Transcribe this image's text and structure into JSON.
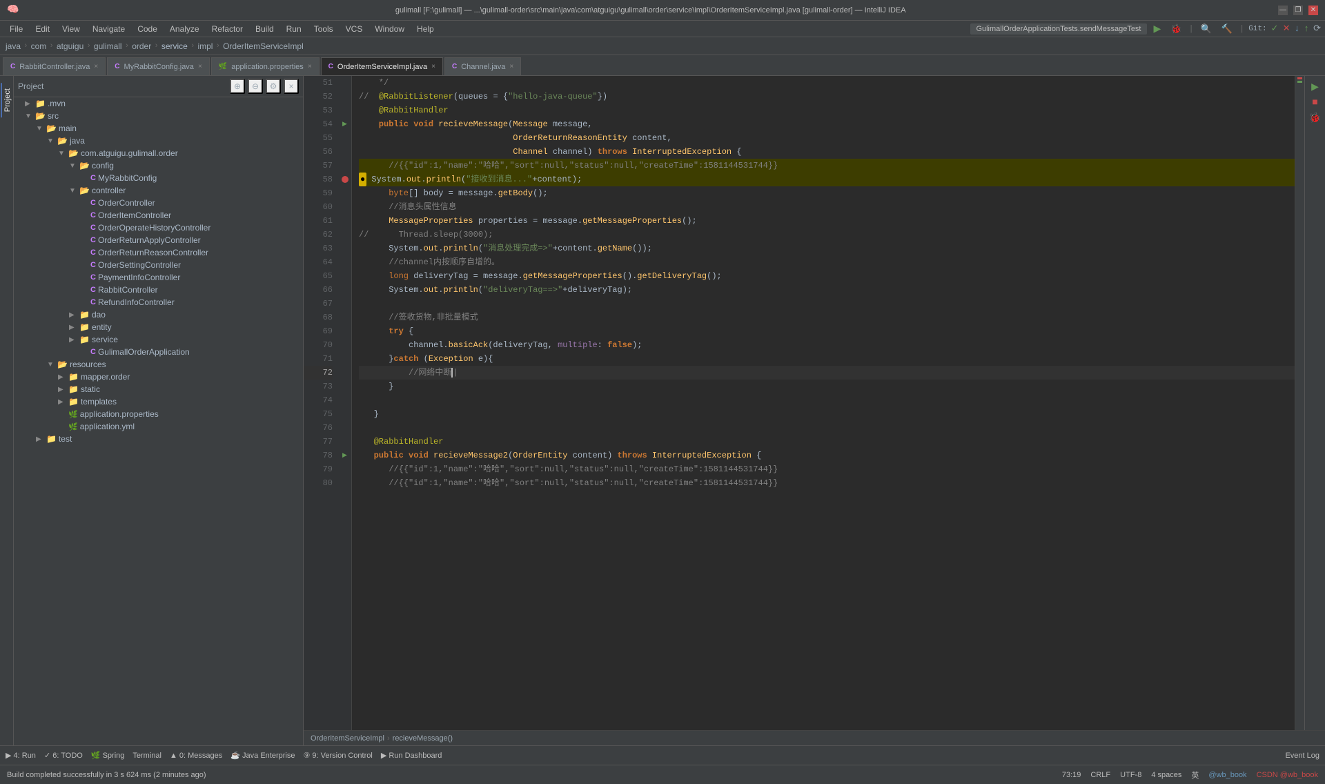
{
  "window": {
    "title": "gulimall [F:\\gulimall] — ...\\gulimall-order\\src\\main\\java\\com\\atguigu\\gulimall\\order\\service\\impl\\OrderItemServiceImpl.java [gulimall-order] — IntelliJ IDEA",
    "controls": [
      "—",
      "❐",
      "✕"
    ]
  },
  "menu": {
    "items": [
      "File",
      "Edit",
      "View",
      "Navigate",
      "Code",
      "Analyze",
      "Refactor",
      "Build",
      "Run",
      "Tools",
      "VCS",
      "Window",
      "Help"
    ]
  },
  "breadcrumb": {
    "items": [
      "java",
      "com",
      "atguigu",
      "gulimall",
      "order",
      "service",
      "impl",
      "OrderItemServiceImpl"
    ]
  },
  "tabs": [
    {
      "label": "RabbitController.java",
      "active": false,
      "icon": "C"
    },
    {
      "label": "MyRabbitConfig.java",
      "active": false,
      "icon": "C"
    },
    {
      "label": "application.properties",
      "active": false,
      "icon": "P"
    },
    {
      "label": "OrderItemServiceImpl.java",
      "active": true,
      "icon": "C"
    },
    {
      "label": "Channel.java",
      "active": false,
      "icon": "C"
    }
  ],
  "run_config": {
    "label": "GulimallOrderApplicationTests.sendMessageTest"
  },
  "sidebar": {
    "title": "Project",
    "tree": [
      {
        "indent": 1,
        "type": "folder",
        "label": ".mvn",
        "expanded": false
      },
      {
        "indent": 1,
        "type": "folder",
        "label": "src",
        "expanded": true
      },
      {
        "indent": 2,
        "type": "folder",
        "label": "main",
        "expanded": true
      },
      {
        "indent": 3,
        "type": "folder",
        "label": "java",
        "expanded": true
      },
      {
        "indent": 4,
        "type": "folder",
        "label": "com.atguigu.gulimall.order",
        "expanded": true
      },
      {
        "indent": 5,
        "type": "folder",
        "label": "config",
        "expanded": true
      },
      {
        "indent": 6,
        "type": "file-c",
        "label": "MyRabbitConfig"
      },
      {
        "indent": 5,
        "type": "folder",
        "label": "controller",
        "expanded": true
      },
      {
        "indent": 6,
        "type": "file-c",
        "label": "OrderController"
      },
      {
        "indent": 6,
        "type": "file-c",
        "label": "OrderItemController"
      },
      {
        "indent": 6,
        "type": "file-c",
        "label": "OrderOperateHistoryController"
      },
      {
        "indent": 6,
        "type": "file-c",
        "label": "OrderReturnApplyController"
      },
      {
        "indent": 6,
        "type": "file-c",
        "label": "OrderReturnReasonController"
      },
      {
        "indent": 6,
        "type": "file-c",
        "label": "OrderSettingController"
      },
      {
        "indent": 6,
        "type": "file-c",
        "label": "PaymentInfoController"
      },
      {
        "indent": 6,
        "type": "file-c",
        "label": "RabbitController"
      },
      {
        "indent": 6,
        "type": "file-c",
        "label": "RefundInfoController"
      },
      {
        "indent": 5,
        "type": "folder",
        "label": "dao",
        "expanded": false
      },
      {
        "indent": 5,
        "type": "folder",
        "label": "entity",
        "expanded": false
      },
      {
        "indent": 5,
        "type": "folder",
        "label": "service",
        "expanded": false,
        "highlight": true
      },
      {
        "indent": 6,
        "type": "file-c",
        "label": "GulimallOrderApplication"
      },
      {
        "indent": 3,
        "type": "folder",
        "label": "resources",
        "expanded": true
      },
      {
        "indent": 4,
        "type": "folder",
        "label": "mapper.order",
        "expanded": false
      },
      {
        "indent": 4,
        "type": "folder",
        "label": "static",
        "expanded": false
      },
      {
        "indent": 4,
        "type": "folder",
        "label": "templates",
        "expanded": false
      },
      {
        "indent": 4,
        "type": "file-p",
        "label": "application.properties"
      },
      {
        "indent": 4,
        "type": "file-p",
        "label": "application.yml"
      },
      {
        "indent": 2,
        "type": "folder",
        "label": "test",
        "expanded": false
      }
    ]
  },
  "code": {
    "lines": [
      {
        "num": 51,
        "gutter": "none",
        "content": "    */",
        "highlight": false,
        "cursor": false,
        "style": "comment"
      },
      {
        "num": 52,
        "gutter": "none",
        "content": "    @RabbitListener(queues = {\"hello-java-queue\"})",
        "highlight": false,
        "cursor": false,
        "style": "annotation-commented"
      },
      {
        "num": 53,
        "gutter": "none",
        "content": "    @RabbitHandler",
        "highlight": false,
        "cursor": false,
        "style": "annotation"
      },
      {
        "num": 54,
        "gutter": "none",
        "content": "    public void recieveMessage(Message message,",
        "highlight": false,
        "cursor": false,
        "style": "method"
      },
      {
        "num": 55,
        "gutter": "method",
        "content": "                               OrderReturnReasonEntity content,",
        "highlight": false,
        "cursor": false,
        "style": "param"
      },
      {
        "num": 56,
        "gutter": "none",
        "content": "                               Channel channel) throws InterruptedException {",
        "highlight": false,
        "cursor": false,
        "style": "param"
      },
      {
        "num": 57,
        "gutter": "none",
        "content": "      //{{\"id\":1,\"name\":\"哈哈\",\"sort\":null,\"status\":null,\"createTime\":1581144531744}}",
        "highlight": true,
        "cursor": false,
        "style": "comment-json"
      },
      {
        "num": 58,
        "gutter": "breakpoint",
        "content": "      System.out.println(\"接收到消息...\"+content);",
        "highlight": true,
        "cursor": true,
        "style": "print"
      },
      {
        "num": 59,
        "gutter": "none",
        "content": "      byte[] body = message.getBody();",
        "highlight": false,
        "cursor": false,
        "style": "code"
      },
      {
        "num": 60,
        "gutter": "none",
        "content": "      //消息头属性信息",
        "highlight": false,
        "cursor": false,
        "style": "comment"
      },
      {
        "num": 61,
        "gutter": "none",
        "content": "      MessageProperties properties = message.getMessageProperties();",
        "highlight": false,
        "cursor": false,
        "style": "code"
      },
      {
        "num": 62,
        "gutter": "none",
        "content": "//      Thread.sleep(3000);",
        "highlight": false,
        "cursor": false,
        "style": "comment"
      },
      {
        "num": 63,
        "gutter": "none",
        "content": "      System.out.println(\"消息处理完成=>\"+content.getName());",
        "highlight": false,
        "cursor": false,
        "style": "print"
      },
      {
        "num": 64,
        "gutter": "none",
        "content": "      //channel内按顺序自增的。",
        "highlight": false,
        "cursor": false,
        "style": "comment"
      },
      {
        "num": 65,
        "gutter": "none",
        "content": "      long deliveryTag = message.getMessageProperties().getDeliveryTag();",
        "highlight": false,
        "cursor": false,
        "style": "code"
      },
      {
        "num": 66,
        "gutter": "none",
        "content": "      System.out.println(\"deliveryTag==>\"+deliveryTag);",
        "highlight": false,
        "cursor": false,
        "style": "print"
      },
      {
        "num": 67,
        "gutter": "none",
        "content": "      ",
        "highlight": false,
        "cursor": false,
        "style": "empty"
      },
      {
        "num": 68,
        "gutter": "none",
        "content": "      //签收货物,非批量模式",
        "highlight": false,
        "cursor": false,
        "style": "comment"
      },
      {
        "num": 69,
        "gutter": "none",
        "content": "      try {",
        "highlight": false,
        "cursor": false,
        "style": "code"
      },
      {
        "num": 70,
        "gutter": "none",
        "content": "          channel.basicAck(deliveryTag, multiple: false);",
        "highlight": false,
        "cursor": false,
        "style": "code"
      },
      {
        "num": 71,
        "gutter": "none",
        "content": "      }catch (Exception e){",
        "highlight": false,
        "cursor": false,
        "style": "code"
      },
      {
        "num": 72,
        "gutter": "none",
        "content": "          //网络中断|",
        "highlight": false,
        "cursor": false,
        "style": "comment-cursor"
      },
      {
        "num": 73,
        "gutter": "none",
        "content": "      }",
        "highlight": false,
        "cursor": false,
        "style": "code"
      },
      {
        "num": 74,
        "gutter": "none",
        "content": "      ",
        "highlight": false,
        "cursor": false,
        "style": "empty"
      },
      {
        "num": 75,
        "gutter": "none",
        "content": "   }",
        "highlight": false,
        "cursor": false,
        "style": "code"
      },
      {
        "num": 76,
        "gutter": "none",
        "content": "   ",
        "highlight": false,
        "cursor": false,
        "style": "empty"
      },
      {
        "num": 77,
        "gutter": "none",
        "content": "   @RabbitHandler",
        "highlight": false,
        "cursor": false,
        "style": "annotation"
      },
      {
        "num": 78,
        "gutter": "method",
        "content": "   public void recieveMessage2(OrderEntity content) throws InterruptedException {",
        "highlight": false,
        "cursor": false,
        "style": "method"
      },
      {
        "num": 79,
        "gutter": "none",
        "content": "      //{{\"id\":1,\"name\":\"哈哈\",\"sort\":null,\"status\":null,\"createTime\":1581144531744}}",
        "highlight": false,
        "cursor": false,
        "style": "comment-json"
      }
    ],
    "breadcrumb": "OrderItemServiceImpl > recieveMessage()"
  },
  "status_bar": {
    "build_status": "Build completed successfully in 3 s 624 ms (2 minutes ago)",
    "position": "73:19",
    "line_ending": "CRLF",
    "encoding": "UTF-8",
    "indent": "4 spaces",
    "git_user": "@wb_book"
  },
  "bottom_tabs": [
    {
      "id": "run",
      "label": "▶ 4: Run"
    },
    {
      "id": "todo",
      "label": "✓ 6: TODO"
    },
    {
      "id": "spring",
      "label": "🌿 Spring"
    },
    {
      "id": "terminal",
      "label": "Terminal"
    },
    {
      "id": "problems",
      "label": "▲ 0: Messages"
    },
    {
      "id": "enterprise",
      "label": "☕ Java Enterprise"
    },
    {
      "id": "vcs",
      "label": "⑨ 9: Version Control"
    },
    {
      "id": "dashboard",
      "label": "▶ Run Dashboard"
    }
  ],
  "right_panel": {
    "label": "Event Log"
  },
  "icons": {
    "folder_open": "▼",
    "folder_closed": "▶",
    "file_c": "C",
    "file_p": "P",
    "expand": "⊕",
    "collapse": "⊖",
    "settings": "⚙",
    "close": "×",
    "search": "🔍",
    "run": "▶",
    "debug": "🐞",
    "build": "🔨",
    "git_check": "✓",
    "git_x": "✕"
  }
}
